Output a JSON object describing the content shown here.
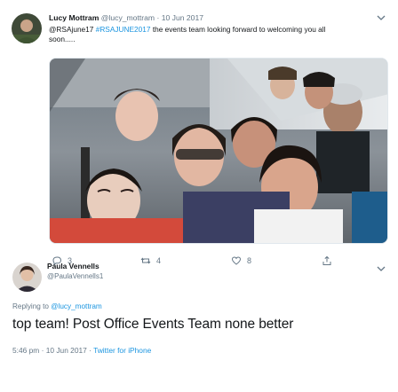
{
  "quoted_tweet": {
    "author_name": "Lucy Mottram",
    "author_handle": "@lucy_mottram",
    "separator": "·",
    "date": "10 Jun 2017",
    "text_prefix": "@RSAjune17 ",
    "hashtag": "#RSAJUNE2017",
    "text_suffix": " the events team looking forward to welcoming you all soon.....",
    "actions": {
      "replies": "3",
      "retweets": "4",
      "likes": "8"
    }
  },
  "reply_tweet": {
    "author_name": "Paula Vennells",
    "author_handle": "@PaulaVennells1",
    "replying_to_label": "Replying to ",
    "replying_to_handle": "@lucy_mottram",
    "text": "top team! Post Office Events Team none better",
    "time": "5:46 pm · 10 Jun 2017",
    "separator": " · ",
    "source": "Twitter for iPhone"
  },
  "colors": {
    "link": "#1b95e0",
    "muted": "#657786",
    "text": "#14171a"
  }
}
